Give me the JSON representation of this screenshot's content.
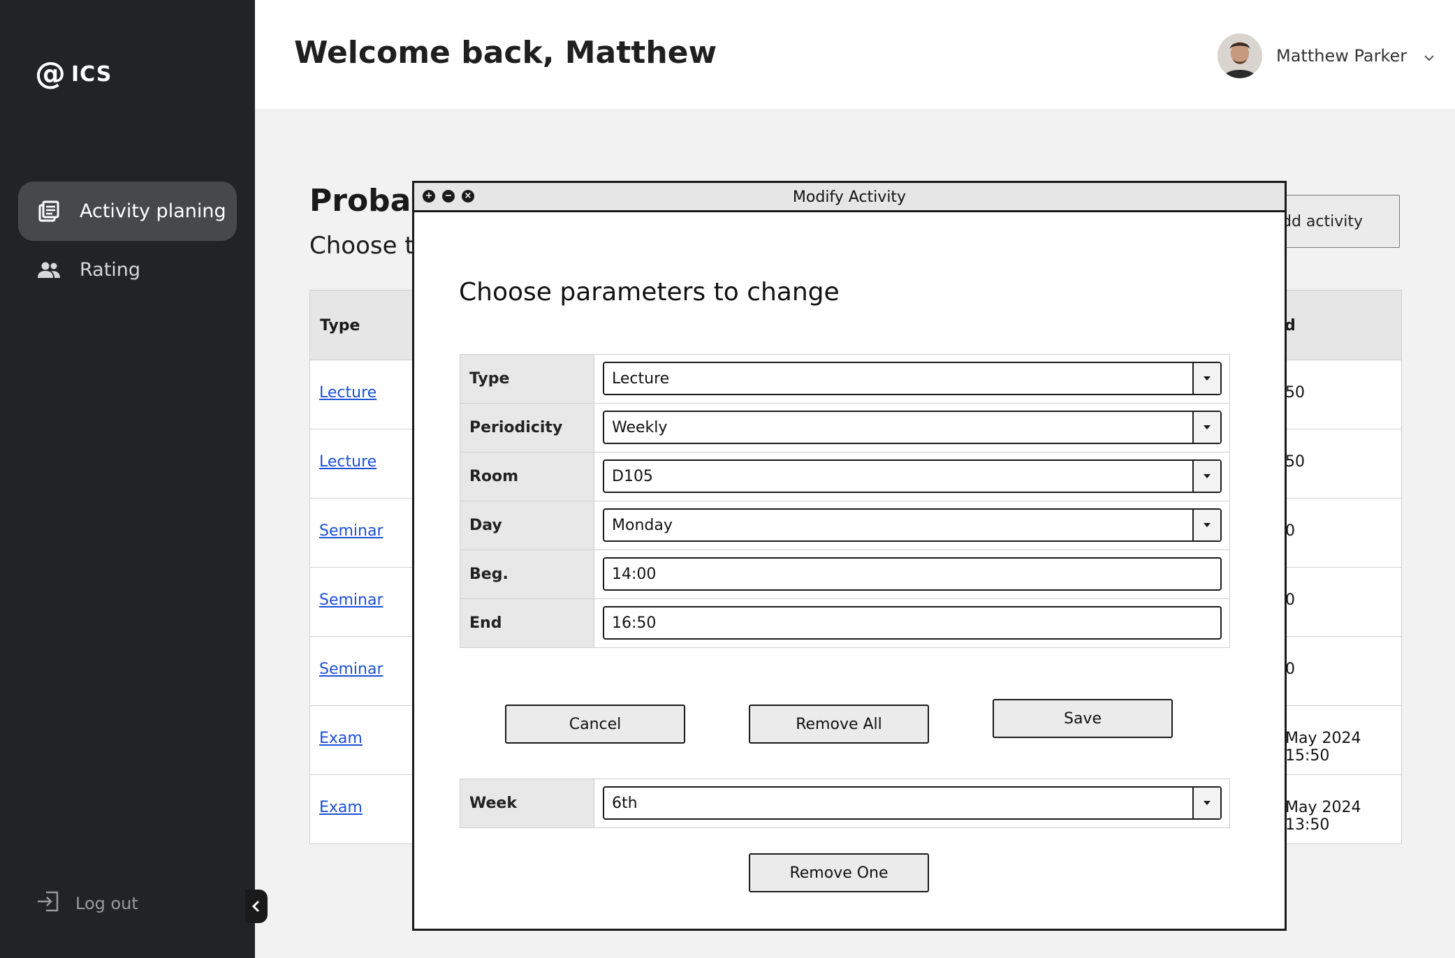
{
  "sidebar": {
    "logo_symbol": "@",
    "logo_text": "ICS",
    "items": [
      {
        "label": "Activity planing",
        "icon": "list-icon",
        "active": true
      },
      {
        "label": "Rating",
        "icon": "people-icon",
        "active": false
      }
    ],
    "logout_label": "Log out"
  },
  "header": {
    "welcome": "Welcome back, Matthew",
    "user_name": "Matthew Parker"
  },
  "main": {
    "title": "Probab",
    "subtitle": "Choose th",
    "add_button": "dd activity",
    "table": {
      "col_type": "Type",
      "col_end": "d",
      "rows": [
        {
          "type": "Lecture",
          "end": "50"
        },
        {
          "type": "Lecture",
          "end": "50"
        },
        {
          "type": "Seminar",
          "end": "0"
        },
        {
          "type": "Seminar",
          "end": "0"
        },
        {
          "type": "Seminar",
          "end": "0"
        },
        {
          "type": "Exam",
          "end": "May 2024 15:50"
        },
        {
          "type": "Exam",
          "end": "May 2024 13:50"
        }
      ]
    }
  },
  "modal": {
    "title": "Modify Activity",
    "heading": "Choose parameters to change",
    "fields": {
      "type": {
        "label": "Type",
        "value": "Lecture"
      },
      "periodicity": {
        "label": "Periodicity",
        "value": "Weekly"
      },
      "room": {
        "label": "Room",
        "value": "D105"
      },
      "day": {
        "label": "Day",
        "value": "Monday"
      },
      "beg": {
        "label": "Beg.",
        "value": "14:00"
      },
      "end": {
        "label": "End",
        "value": "16:50"
      }
    },
    "buttons": {
      "cancel": "Cancel",
      "remove_all": "Remove All",
      "save": "Save",
      "remove_one": "Remove One"
    },
    "week": {
      "label": "Week",
      "value": "6th"
    }
  }
}
